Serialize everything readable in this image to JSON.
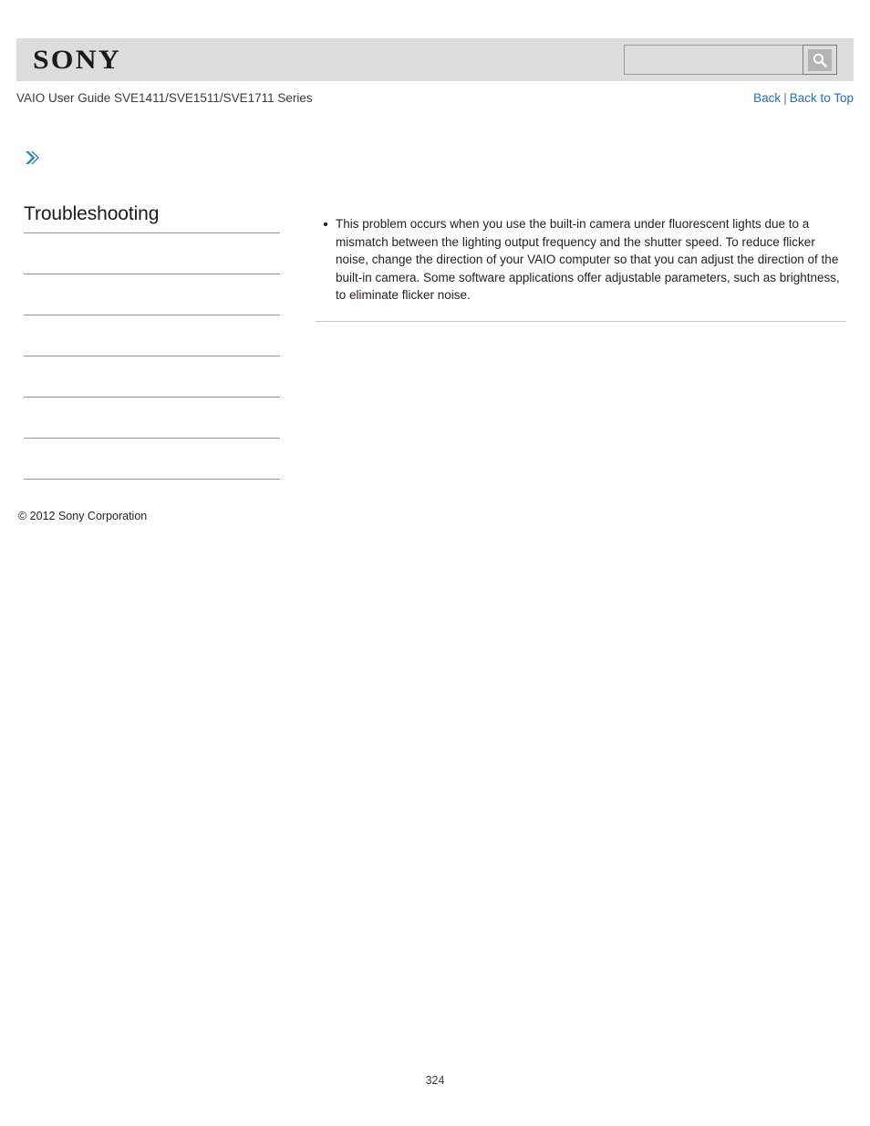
{
  "header": {
    "logo_text": "SONY",
    "band_color": "#dcdcdc",
    "search": {
      "value": "",
      "placeholder": "",
      "icon": "magnifier-icon"
    }
  },
  "subheader": {
    "guide_title": "VAIO User Guide SVE1411/SVE1511/SVE1711 Series",
    "links": {
      "back": "Back",
      "separator": "|",
      "back_to_top": "Back to Top"
    },
    "link_color": "#1d6fc4"
  },
  "breadcrumb_icon": "chevron-right-icon",
  "sidebar": {
    "title": "Troubleshooting",
    "items": [
      {
        "label": ""
      },
      {
        "label": ""
      },
      {
        "label": ""
      },
      {
        "label": ""
      },
      {
        "label": ""
      },
      {
        "label": ""
      }
    ]
  },
  "main": {
    "bullets": [
      "This problem occurs when you use the built-in camera under fluorescent lights due to a mismatch between the lighting output frequency and the shutter speed. To reduce flicker noise, change the direction of your VAIO computer so that you can adjust the direction of the built-in camera. Some software applications offer adjustable parameters, such as brightness, to eliminate flicker noise."
    ]
  },
  "footer": {
    "copyright": "© 2012 Sony Corporation",
    "page_number": "324"
  }
}
